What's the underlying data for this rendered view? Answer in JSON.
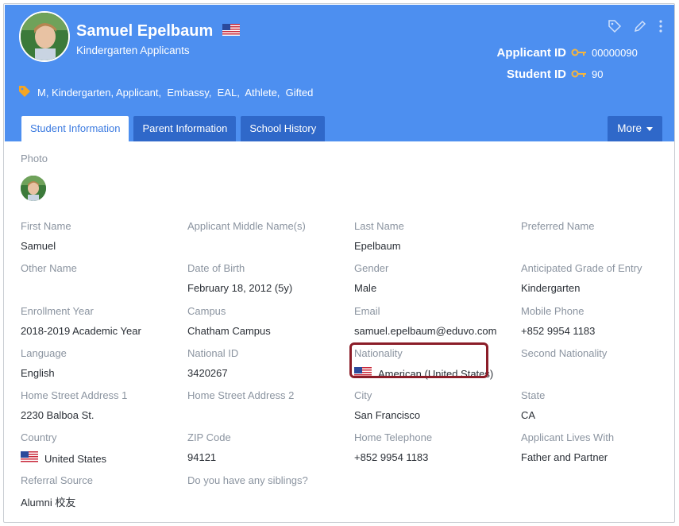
{
  "profile": {
    "name": "Samuel Epelbaum",
    "group": "Kindergarten Applicants",
    "applicant_id_label": "Applicant ID",
    "applicant_id": "00000090",
    "student_id_label": "Student ID",
    "student_id": "90",
    "tags": "M, Kindergarten, Applicant,  Embassy,  EAL,  Athlete,  Gifted"
  },
  "tabs": [
    "Student Information",
    "Parent Information",
    "School History"
  ],
  "more_label": "More",
  "photo_label": "Photo",
  "fields": [
    {
      "label": "First Name",
      "value": "Samuel"
    },
    {
      "label": "Applicant Middle Name(s)",
      "value": ""
    },
    {
      "label": "Last Name",
      "value": "Epelbaum"
    },
    {
      "label": "Preferred Name",
      "value": ""
    },
    {
      "label": "Other Name",
      "value": ""
    },
    {
      "label": "Date of Birth",
      "value": "February 18, 2012 (5y)"
    },
    {
      "label": "Gender",
      "value": "Male"
    },
    {
      "label": "Anticipated Grade of Entry",
      "value": "Kindergarten"
    },
    {
      "label": "Enrollment Year",
      "value": "2018-2019 Academic Year"
    },
    {
      "label": "Campus",
      "value": "Chatham Campus"
    },
    {
      "label": "Email",
      "value": "samuel.epelbaum@eduvo.com"
    },
    {
      "label": "Mobile Phone",
      "value": "+852 9954 1183"
    },
    {
      "label": "Language",
      "value": "English"
    },
    {
      "label": "National ID",
      "value": "3420267"
    },
    {
      "label": "Nationality",
      "value": "American (United States)"
    },
    {
      "label": "Second Nationality",
      "value": ""
    },
    {
      "label": "Home Street Address 1",
      "value": "2230 Balboa St."
    },
    {
      "label": "Home Street Address 2",
      "value": ""
    },
    {
      "label": "City",
      "value": "San Francisco"
    },
    {
      "label": "State",
      "value": "CA"
    },
    {
      "label": "Country",
      "value": "United States"
    },
    {
      "label": "ZIP Code",
      "value": "94121"
    },
    {
      "label": "Home Telephone",
      "value": "+852 9954 1183"
    },
    {
      "label": "Applicant Lives With",
      "value": "Father and Partner"
    },
    {
      "label": "Referral Source",
      "value": "Alumni 校友"
    },
    {
      "label": "Do you have any siblings?",
      "value": ""
    }
  ],
  "colors": {
    "header": "#4d8ff0",
    "tab_dark": "#2f68c9",
    "key_icon": "#f5b53d",
    "tag_icon": "#f5a623",
    "highlight": "#8b1d28"
  },
  "icons": [
    "tag-outline-icon",
    "pencil-icon",
    "kebab-menu-icon",
    "key-icon",
    "tag-icon",
    "us-flag-icon"
  ]
}
